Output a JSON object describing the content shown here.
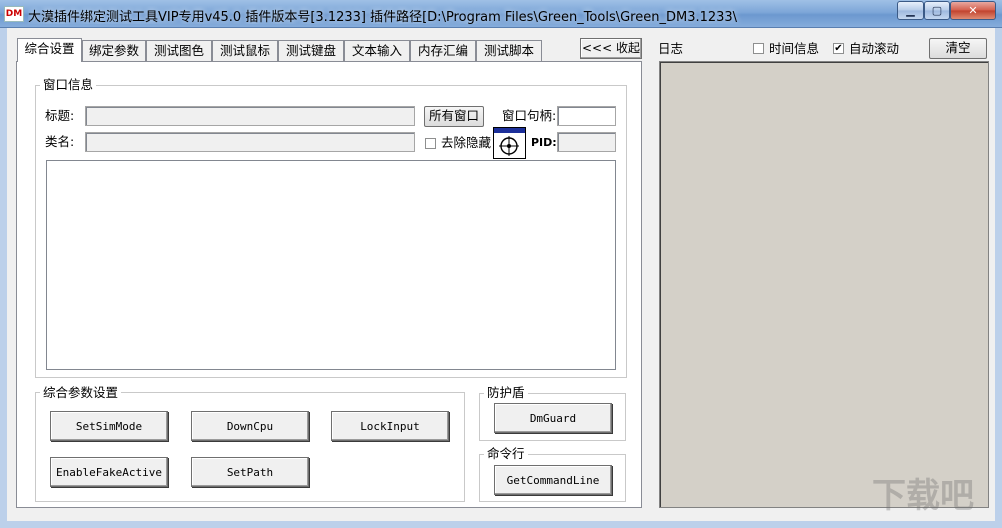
{
  "window": {
    "icon_text": "DM",
    "title": "大漠插件绑定测试工具VIP专用v45.0 插件版本号[3.1233] 插件路径[D:\\Program Files\\Green_Tools\\Green_DM3.1233\\"
  },
  "caption_buttons": {
    "minimize": "▁",
    "maximize": "▢",
    "close": "✕"
  },
  "tabs": [
    {
      "label": "综合设置",
      "active": true
    },
    {
      "label": "绑定参数"
    },
    {
      "label": "测试图色"
    },
    {
      "label": "测试鼠标"
    },
    {
      "label": "测试键盘"
    },
    {
      "label": "文本输入"
    },
    {
      "label": "内存汇编"
    },
    {
      "label": "测试脚本"
    }
  ],
  "collapse_button": "<<< 收起",
  "window_info": {
    "group_label": "窗口信息",
    "title_label": "标题:",
    "title_value": "",
    "classname_label": "类名:",
    "classname_value": "",
    "all_windows_button": "所有窗口",
    "handle_label": "窗口句柄:",
    "handle_value": "",
    "remove_hidden_label": "去除隐藏",
    "remove_hidden_checked": false,
    "pid_label": "PID:",
    "pid_value": ""
  },
  "general_params": {
    "group_label": "综合参数设置",
    "buttons": [
      "SetSimMode",
      "DownCpu",
      "LockInput",
      "EnableFakeActive",
      "SetPath"
    ]
  },
  "guard": {
    "group_label": "防护盾",
    "button": "DmGuard"
  },
  "command_line": {
    "group_label": "命令行",
    "button": "GetCommandLine"
  },
  "log": {
    "label": "日志",
    "time_info_label": "时间信息",
    "time_info_checked": false,
    "auto_scroll_label": "自动滚动",
    "auto_scroll_checked": true,
    "clear_button": "清空"
  },
  "watermark": "下载吧"
}
